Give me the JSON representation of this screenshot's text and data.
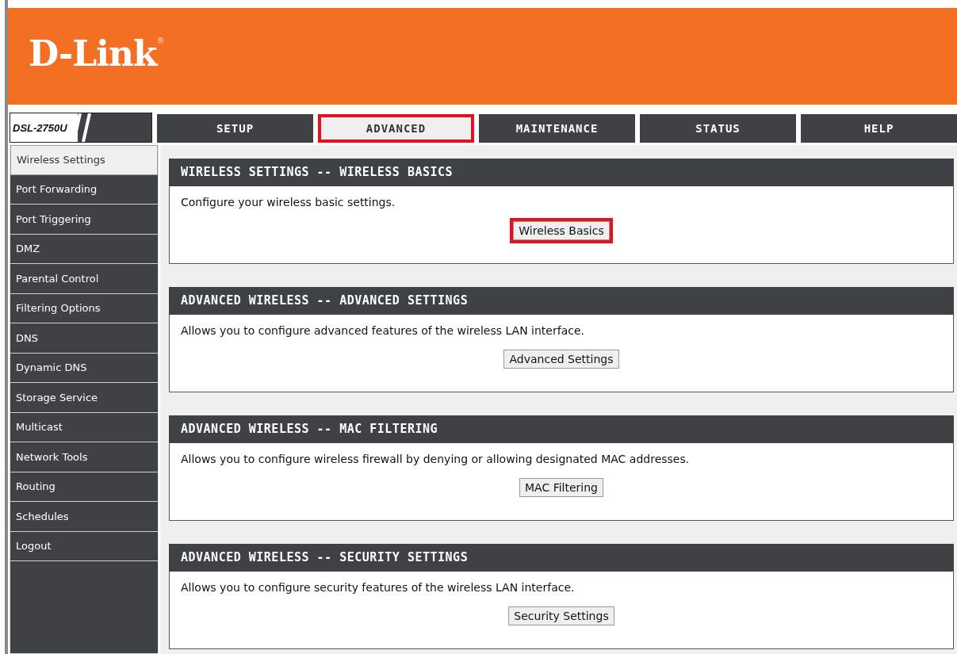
{
  "brand": {
    "logo": "D-Link",
    "trademark": "®"
  },
  "model": "DSL-2750U",
  "tabs": [
    {
      "label": "SETUP",
      "selected": false,
      "highlighted": false
    },
    {
      "label": "ADVANCED",
      "selected": true,
      "highlighted": true
    },
    {
      "label": "MAINTENANCE",
      "selected": false,
      "highlighted": false
    },
    {
      "label": "STATUS",
      "selected": false,
      "highlighted": false
    },
    {
      "label": "HELP",
      "selected": false,
      "highlighted": false
    }
  ],
  "sidebar": {
    "items": [
      {
        "label": "Wireless Settings",
        "selected": true
      },
      {
        "label": "Port Forwarding",
        "selected": false
      },
      {
        "label": "Port Triggering",
        "selected": false
      },
      {
        "label": "DMZ",
        "selected": false
      },
      {
        "label": "Parental Control",
        "selected": false
      },
      {
        "label": "Filtering Options",
        "selected": false
      },
      {
        "label": "DNS",
        "selected": false
      },
      {
        "label": "Dynamic DNS",
        "selected": false
      },
      {
        "label": "Storage Service",
        "selected": false
      },
      {
        "label": "Multicast",
        "selected": false
      },
      {
        "label": "Network Tools",
        "selected": false
      },
      {
        "label": "Routing",
        "selected": false
      },
      {
        "label": "Schedules",
        "selected": false
      },
      {
        "label": "Logout",
        "selected": false
      }
    ]
  },
  "sections": [
    {
      "title": "WIRELESS SETTINGS -- WIRELESS BASICS",
      "text": "Configure your wireless basic settings.",
      "button": "Wireless Basics",
      "highlighted": true
    },
    {
      "title": "ADVANCED WIRELESS -- ADVANCED SETTINGS",
      "text": "Allows you to configure advanced features of the wireless LAN interface.",
      "button": "Advanced Settings",
      "highlighted": false
    },
    {
      "title": "ADVANCED WIRELESS -- MAC FILTERING",
      "text": "Allows you to configure wireless firewall by denying or allowing designated MAC addresses.",
      "button": "MAC Filtering",
      "highlighted": false
    },
    {
      "title": "ADVANCED WIRELESS -- SECURITY SETTINGS",
      "text": "Allows you to configure security features of the wireless LAN interface.",
      "button": "Security Settings",
      "highlighted": false
    }
  ]
}
